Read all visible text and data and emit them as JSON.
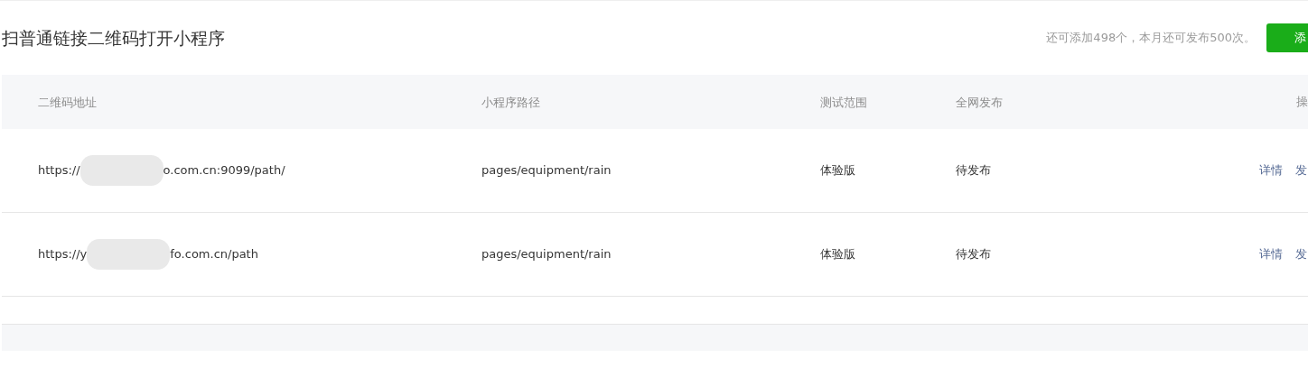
{
  "title": "扫普通链接二维码打开小程序",
  "quota": "还可添加498个，本月还可发布500次。",
  "add_button": "添",
  "columns": [
    "二维码地址",
    "小程序路径",
    "测试范围",
    "全网发布",
    "操"
  ],
  "rows": [
    {
      "url_start": "https://",
      "url_end": "o.com.cn:9099/path/",
      "path": "pages/equipment/rain",
      "scope": "体验版",
      "release": "待发布",
      "actions": [
        "详情",
        "发"
      ]
    },
    {
      "url_start": "https://y",
      "url_end": "fo.com.cn/path",
      "path": "pages/equipment/rain",
      "scope": "体验版",
      "release": "待发布",
      "actions": [
        "详情",
        "发"
      ]
    }
  ]
}
